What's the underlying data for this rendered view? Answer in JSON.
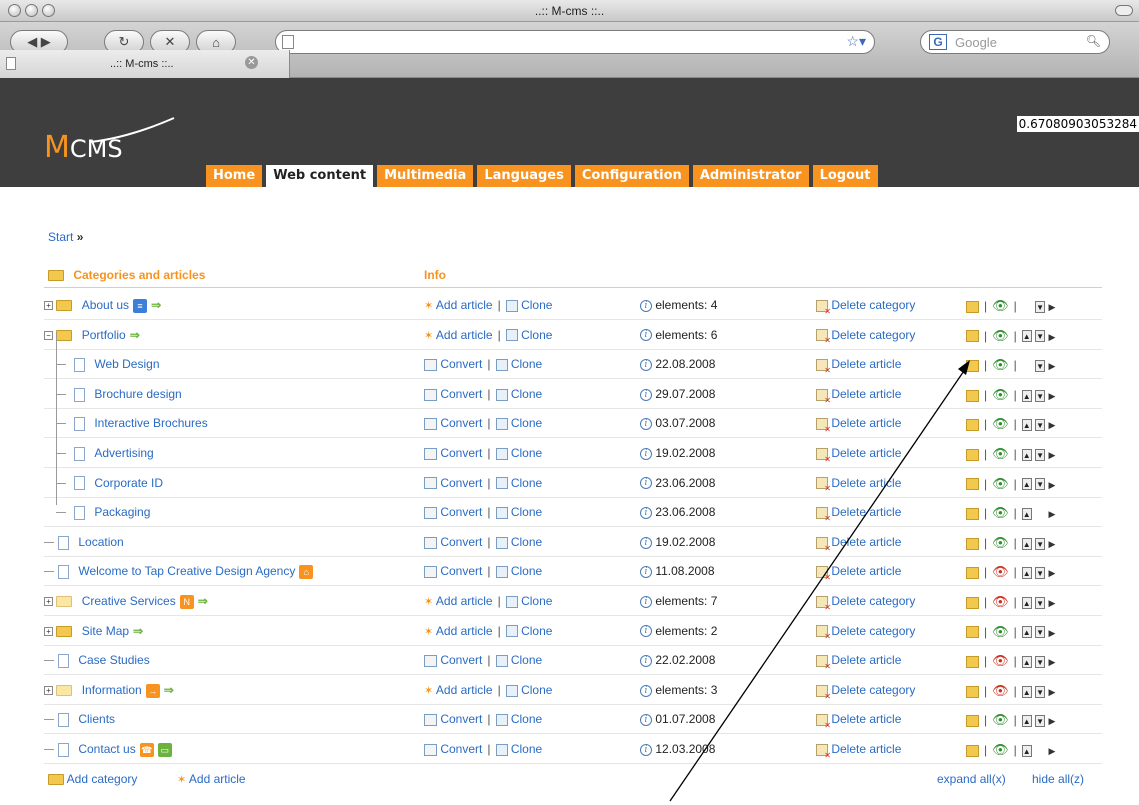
{
  "window": {
    "title": "..:: M-cms ::.."
  },
  "tab": {
    "label": "..:: M-cms ::.."
  },
  "search": {
    "placeholder": "Google"
  },
  "header": {
    "logo_m": "M",
    "logo_text": "CMS",
    "random_value": "0.67080903053284",
    "nav": [
      "Home",
      "Web content",
      "Multimedia",
      "Languages",
      "Configuration",
      "Administrator",
      "Logout"
    ],
    "active_nav": "Web content"
  },
  "breadcrumb": {
    "start": "Start",
    "sep": "»"
  },
  "table": {
    "col_categories": "Categories and articles",
    "col_info": "Info",
    "labels": {
      "add_article": "Add article",
      "clone": "Clone",
      "convert": "Convert",
      "delete_category": "Delete category",
      "delete_article": "Delete article",
      "elements_prefix": "elements: "
    },
    "rows": [
      {
        "name": "About us",
        "type": "category",
        "info": "elements: 4"
      },
      {
        "name": "Portfolio",
        "type": "category",
        "info": "elements: 6"
      },
      {
        "name": "Web Design",
        "type": "article",
        "info": "22.08.2008"
      },
      {
        "name": "Brochure design",
        "type": "article",
        "info": "29.07.2008"
      },
      {
        "name": "Interactive Brochures",
        "type": "article",
        "info": "03.07.2008"
      },
      {
        "name": "Advertising",
        "type": "article",
        "info": "19.02.2008"
      },
      {
        "name": "Corporate ID",
        "type": "article",
        "info": "23.06.2008"
      },
      {
        "name": "Packaging",
        "type": "article",
        "info": "23.06.2008"
      },
      {
        "name": "Location",
        "type": "article",
        "info": "19.02.2008"
      },
      {
        "name": "Welcome to Tap Creative Design Agency",
        "type": "article",
        "info": "11.08.2008"
      },
      {
        "name": "Creative Services",
        "type": "category",
        "info": "elements: 7"
      },
      {
        "name": "Site Map",
        "type": "category",
        "info": "elements: 2"
      },
      {
        "name": "Case Studies",
        "type": "article",
        "info": "22.02.2008"
      },
      {
        "name": "Information",
        "type": "category",
        "info": "elements: 3"
      },
      {
        "name": "Clients",
        "type": "article",
        "info": "01.07.2008"
      },
      {
        "name": "Contact us",
        "type": "article",
        "info": "12.03.2008"
      }
    ]
  },
  "footer": {
    "add_category": "Add category",
    "add_article": "Add article",
    "expand_all": "expand all(x)",
    "hide_all": "hide all(z)"
  },
  "colors": {
    "accent": "#f7931e",
    "link": "#2a6bc4",
    "header_bg": "#3e3e3e"
  }
}
